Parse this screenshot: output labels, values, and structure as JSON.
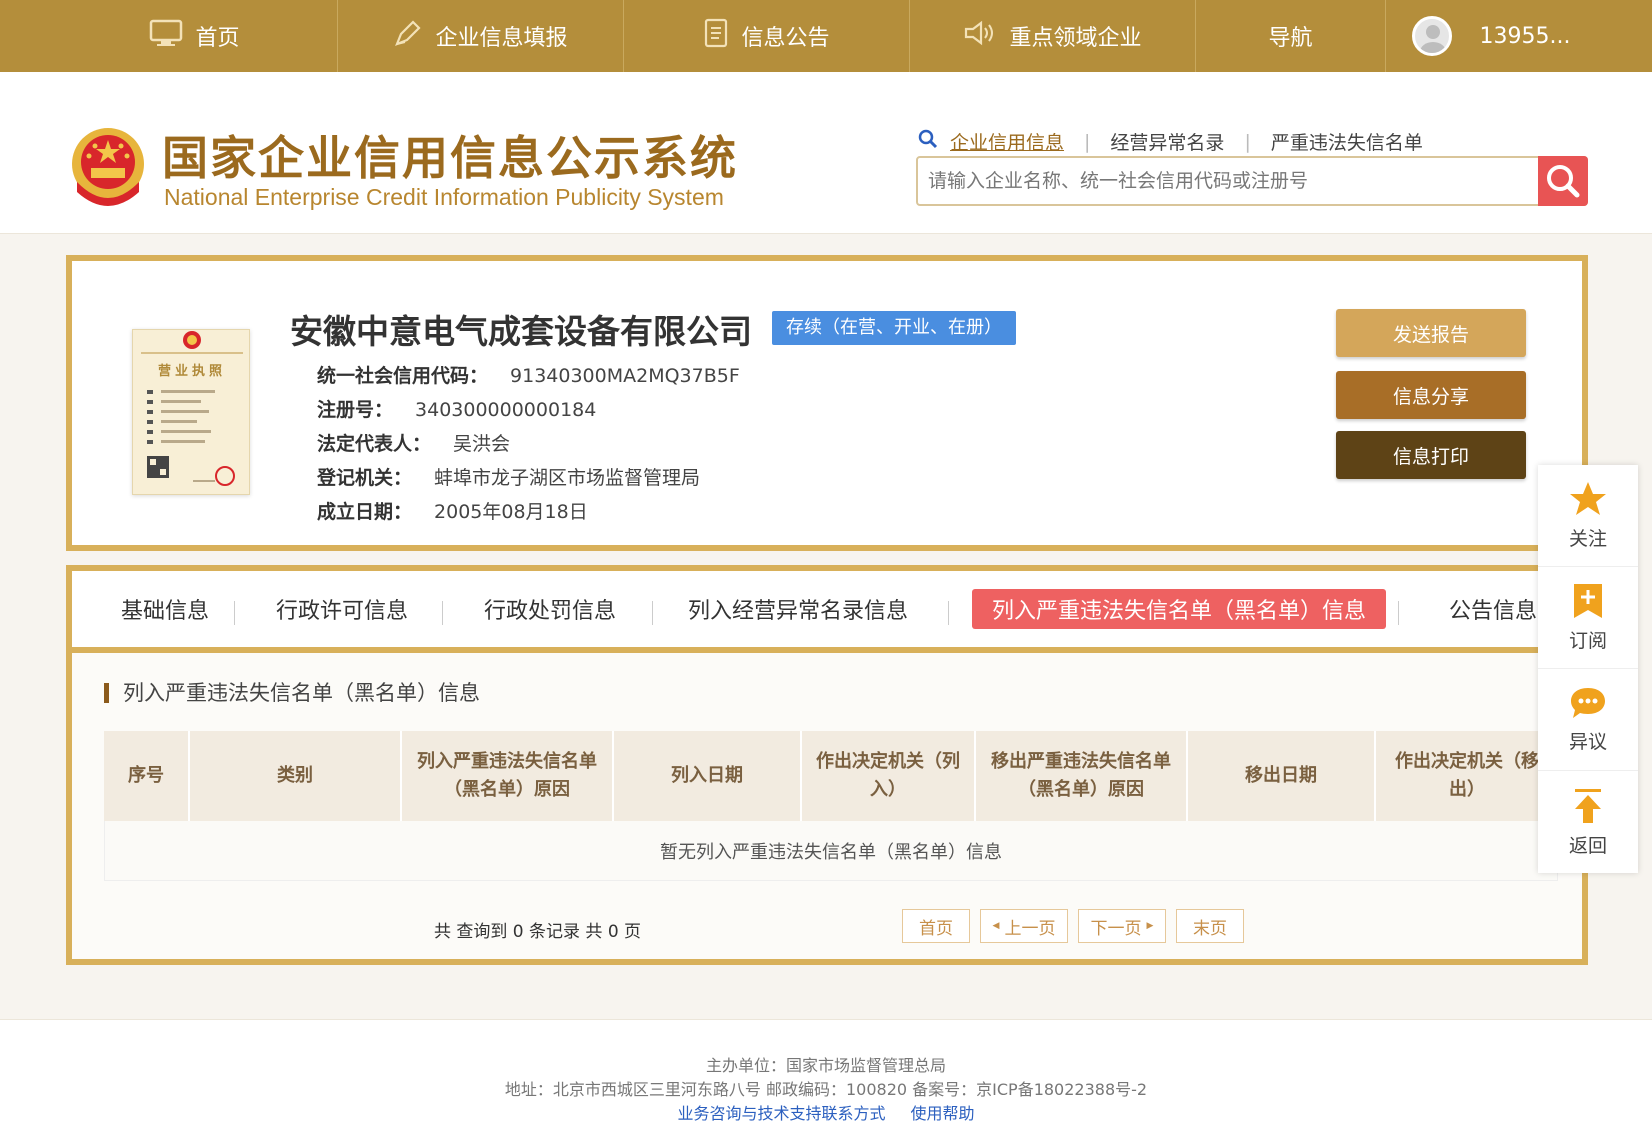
{
  "nav": {
    "items": [
      "首页",
      "企业信息填报",
      "信息公告",
      "重点领域企业",
      "导航"
    ],
    "user": "13955..."
  },
  "header": {
    "title": "国家企业信用信息公示系统",
    "subtitle": "National Enterprise Credit Information Publicity System",
    "search_tabs": [
      "企业信用信息",
      "经营异常名录",
      "严重违法失信名单"
    ],
    "search_placeholder": "请输入企业名称、统一社会信用代码或注册号"
  },
  "company": {
    "name": "安徽中意电气成套设备有限公司",
    "status": "存续（在营、开业、在册）",
    "fields": [
      {
        "label": "统一社会信用代码：",
        "value": "91340300MA2MQ37B5F"
      },
      {
        "label": "注册号：",
        "value": "340300000000184"
      },
      {
        "label": "法定代表人：",
        "value": "吴洪会"
      },
      {
        "label": "登记机关：",
        "value": "蚌埠市龙子湖区市场监督管理局"
      },
      {
        "label": "成立日期：",
        "value": "2005年08月18日"
      }
    ],
    "license_text": "营业执照",
    "actions": [
      "发送报告",
      "信息分享",
      "信息打印"
    ]
  },
  "tabs": {
    "items": [
      "基础信息",
      "行政许可信息",
      "行政处罚信息",
      "列入经营异常名录信息",
      "列入严重违法失信名单（黑名单）信息",
      "公告信息"
    ],
    "active_index": 4
  },
  "section": {
    "title": "列入严重违法失信名单（黑名单）信息",
    "columns": [
      "序号",
      "类别",
      "列入严重违法失信名单（黑名单）原因",
      "列入日期",
      "作出决定机关（列入）",
      "移出严重违法失信名单（黑名单）原因",
      "移出日期",
      "作出决定机关（移出）"
    ],
    "empty_text": "暂无列入严重违法失信名单（黑名单）信息"
  },
  "pagination": {
    "summary": "共 查询到 0 条记录 共 0 页",
    "first": "首页",
    "prev": "上一页",
    "next": "下一页",
    "last": "末页"
  },
  "side_tools": [
    "关注",
    "订阅",
    "异议",
    "返回"
  ],
  "footer": {
    "sponsor": "主办单位：国家市场监督管理总局",
    "address": "地址：北京市西城区三里河东路八号   邮政编码：100820   备案号：京ICP备18022388号-2",
    "links": [
      "业务咨询与技术支持联系方式",
      "使用帮助"
    ]
  },
  "colors": {
    "nav_bg": "#b48e3b",
    "frame": "#d8b05a",
    "active_tab": "#ee6161",
    "badge": "#4a8ee0",
    "btn_send": "#d4a65a",
    "btn_share": "#a86e27",
    "btn_print": "#5e4316"
  }
}
